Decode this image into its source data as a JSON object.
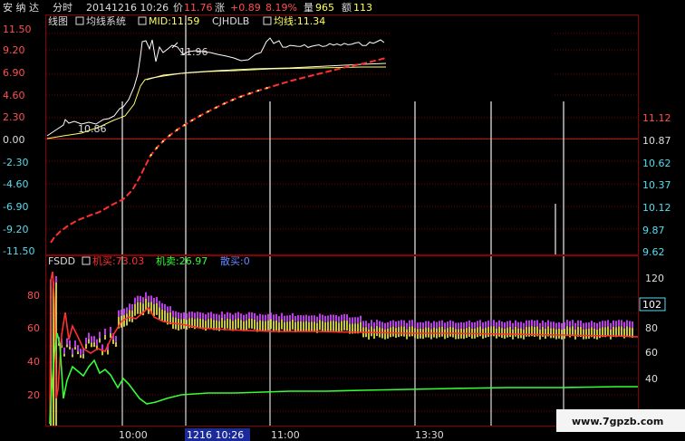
{
  "header": {
    "stock_name": "安 纳 达",
    "view_name": "分时",
    "date_time": "20141216 10:26",
    "price_label": "价",
    "price": "11.76",
    "change_label": "涨",
    "change": "+0.89",
    "change_pct": "8.19%",
    "volume_label": "量",
    "volume": "965",
    "amount_label": "额",
    "amount": "113"
  },
  "upper_legend": {
    "item1": "线图",
    "item2": "均线系统",
    "item3": "MID:11.59",
    "item4": "CJHDLB",
    "item5": "均线:11.34"
  },
  "lower_legend": {
    "name": "FSDD",
    "item1": "机买:73.03",
    "item2": "机卖:26.97",
    "item3": "散买:0"
  },
  "upper_left_axis": [
    "11.50",
    "9.20",
    "6.90",
    "4.60",
    "2.30",
    "0.00",
    "-2.30",
    "-4.60",
    "-6.90",
    "-9.20",
    "-11.50"
  ],
  "upper_right_axis": [
    "11.12",
    "10.87",
    "10.62",
    "10.37",
    "10.12",
    "9.87",
    "9.62"
  ],
  "lower_left_axis": [
    "80",
    "60",
    "40",
    "20"
  ],
  "lower_right_axis": [
    "120",
    "100",
    "80",
    "60",
    "40"
  ],
  "lower_right_current": "102",
  "time_axis": {
    "t1": "10:00",
    "cursor": "1216 10:26",
    "t2": "11:00",
    "t3": "13:30"
  },
  "annotations": {
    "high": "11.96",
    "low": "10.86"
  },
  "watermark": "www.7gpzb.com",
  "colors": {
    "background": "#000000",
    "price_line": "#ffffff",
    "avg_line": "#ffff66",
    "red_line": "#ff3030",
    "green_line": "#33ff33",
    "purple": "#cc44ff",
    "grid": "#8a0000",
    "axis_text_red": "#ff5050",
    "axis_text_cyan": "#55ddee",
    "blue_label": "#6688ff"
  },
  "chart_data": [
    {
      "type": "line",
      "x_range": [
        "09:30",
        "15:00"
      ],
      "ylim_left": [
        -11.5,
        11.5
      ],
      "ylim_right": [
        9.62,
        11.12
      ],
      "series": []
    },
    {
      "type": "line",
      "ylim_left": [
        0,
        100
      ],
      "series": [
        {
          "name": "机买",
          "last_value": 73.03
        },
        {
          "name": "机卖",
          "last_value": 26.97
        },
        {
          "name": "散买",
          "last_value": 0
        }
      ]
    }
  ]
}
